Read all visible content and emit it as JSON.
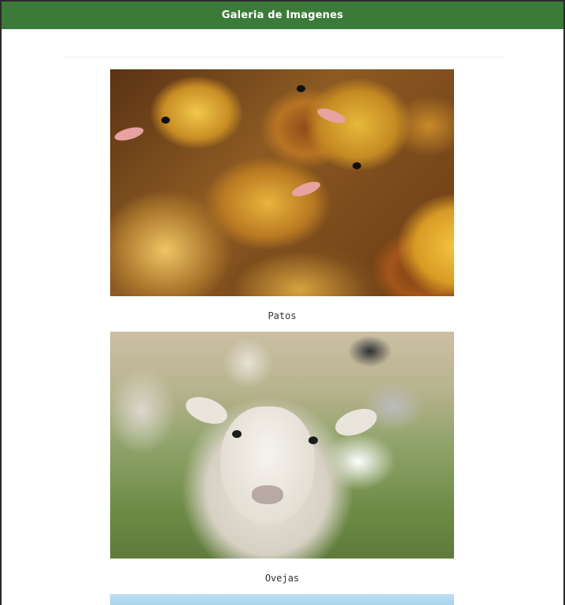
{
  "header": {
    "title": "Galeria de Imagenes",
    "background_color": "#3c7a3a"
  },
  "gallery": {
    "items": [
      {
        "caption": "Patos",
        "image": "ducklings-photo"
      },
      {
        "caption": "Ovejas",
        "image": "sheep-photo"
      },
      {
        "caption": "",
        "image": "sky-photo-partial"
      }
    ]
  }
}
